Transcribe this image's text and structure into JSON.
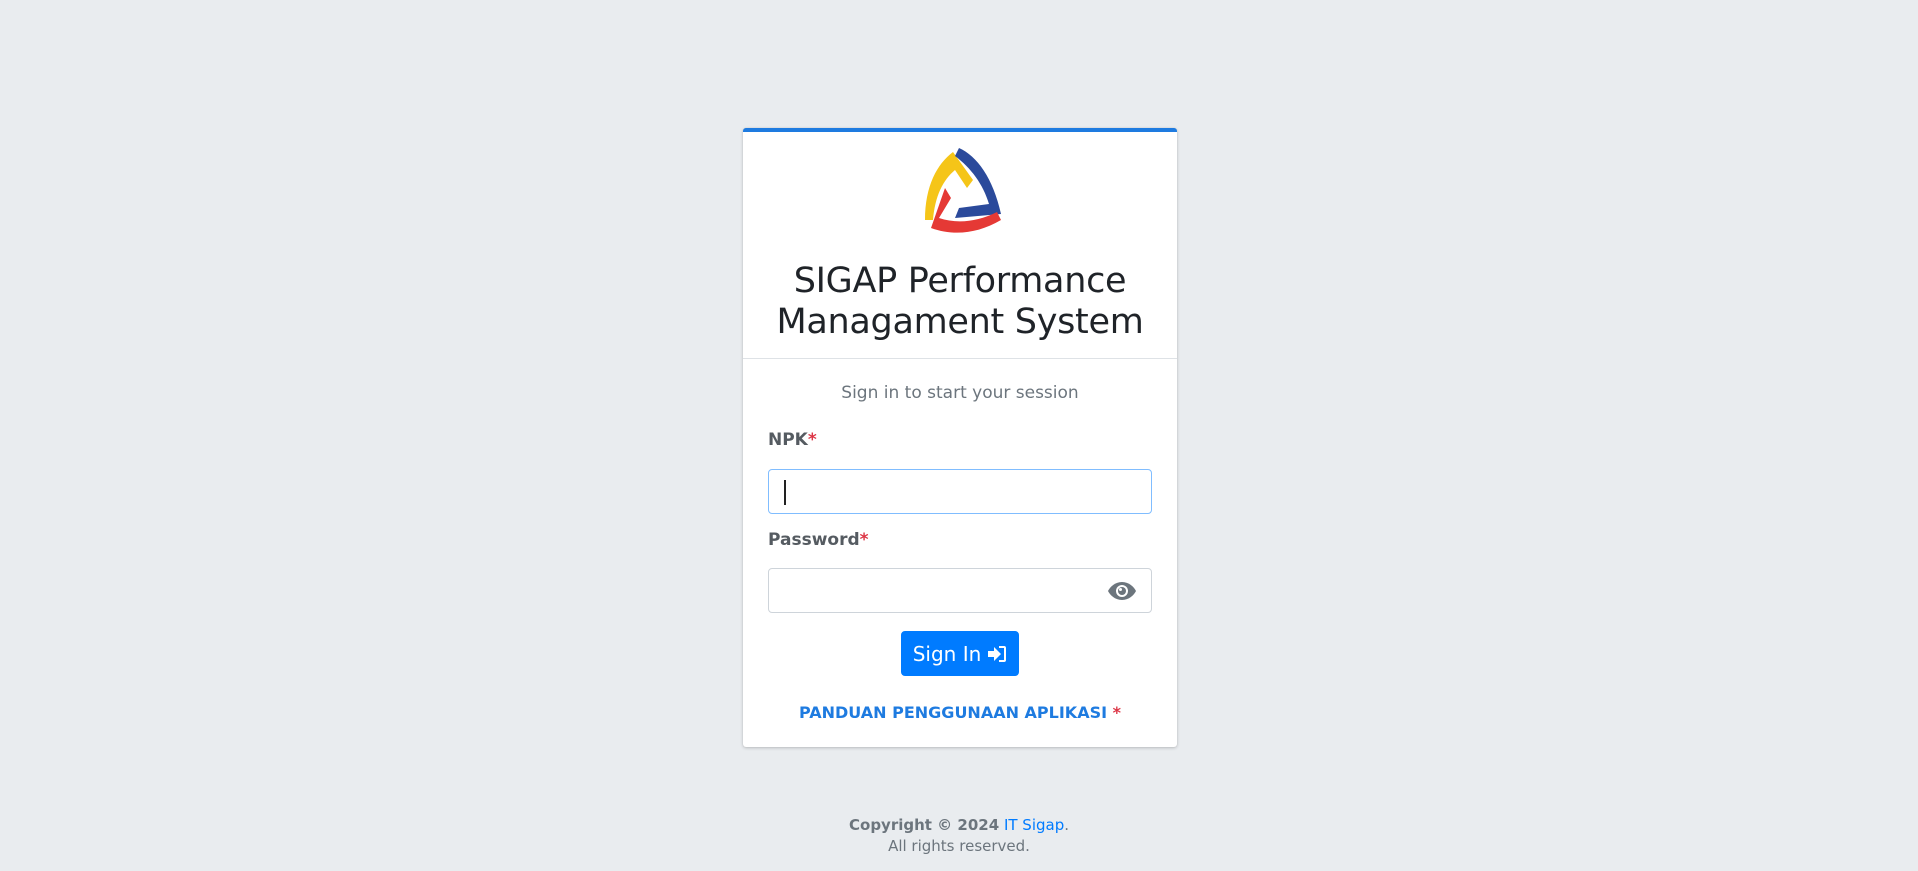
{
  "app": {
    "title": "SIGAP Performance Managament System"
  },
  "login": {
    "session_message": "Sign in to start your session",
    "npk_label": "NPK",
    "password_label": "Password",
    "required_mark": "*",
    "npk_value": "",
    "password_value": "",
    "signin_label": "Sign In",
    "guide_link": "PANDUAN PENGGUNAAN APLIKASI",
    "guide_required_mark": "*"
  },
  "footer": {
    "copyright": "Copyright © 2024",
    "company": "IT Sigap",
    "period": ".",
    "rights": "All rights reserved."
  },
  "icons": {
    "logo": "sigap-logo",
    "eye": "eye-icon",
    "signin": "sign-in-icon"
  },
  "colors": {
    "primary": "#007bff",
    "card_top_border": "#1e7be0",
    "required": "#dc3545",
    "background": "#e9ecef",
    "logo_yellow": "#f5c518",
    "logo_blue": "#2b4a9b",
    "logo_red": "#e53935"
  }
}
